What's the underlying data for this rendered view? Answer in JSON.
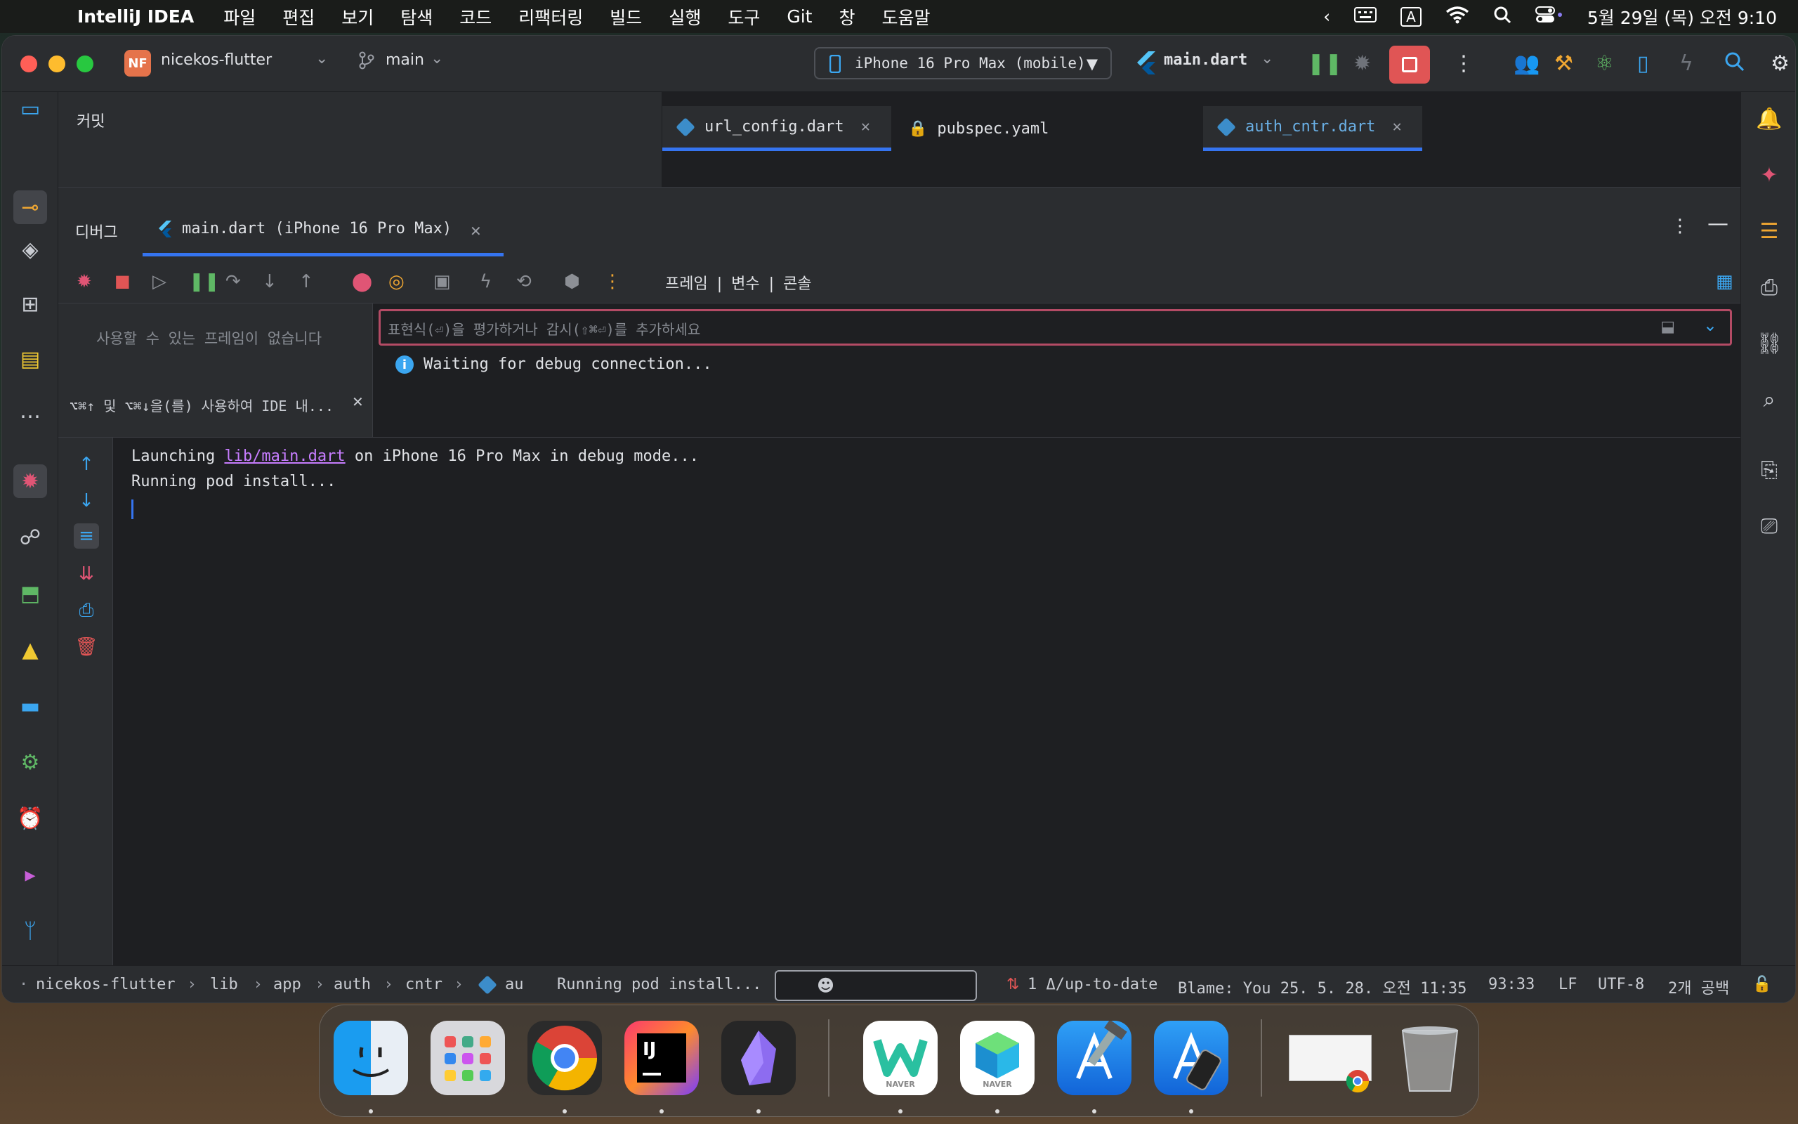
{
  "menubar": {
    "app": "IntelliJ IDEA",
    "items": [
      "파일",
      "편집",
      "보기",
      "탐색",
      "코드",
      "리팩터링",
      "빌드",
      "실행",
      "도구",
      "Git",
      "창",
      "도움말"
    ],
    "input_source": "A",
    "datetime": "5월 29일 (목) 오전 9:10"
  },
  "titlebar": {
    "project_badge": "NF",
    "project": "nicekos-flutter",
    "branch": "main",
    "device": "iPhone 16 Pro Max (mobile)",
    "run_config": "main.dart"
  },
  "commit_panel": {
    "title": "커밋"
  },
  "editor_tabs": [
    {
      "label": "url_config.dart"
    },
    {
      "label": "pubspec.yaml"
    },
    {
      "label": "auth_cntr.dart"
    }
  ],
  "debug": {
    "title": "디버그",
    "session_tab": "main.dart (iPhone 16 Pro Max)",
    "view_tabs": [
      "프레임",
      "|",
      "변수",
      "|",
      "콘솔"
    ],
    "frames_empty": "사용할 수 있는 프레임이 없습니다",
    "frames_hint": "⌥⌘↑ 및 ⌥⌘↓을(를) 사용하여 IDE 내...",
    "eval_placeholder": "표현식(⏎)을 평가하거나 감시(⇧⌘⏎)를 추가하세요",
    "waiting": "Waiting for debug connection...",
    "console": {
      "launch_prefix": "Launching ",
      "launch_link": "lib/main.dart",
      "launch_suffix": " on iPhone 16 Pro Max in debug mode...",
      "line2": "Running pod install..."
    }
  },
  "statusbar": {
    "breadcrumb": [
      "nicekos-flutter",
      "lib",
      "app",
      "auth",
      "cntr",
      "au"
    ],
    "task": "Running pod install...",
    "vcs": "1 Δ/up-to-date",
    "blame": "Blame: You 25. 5. 28. 오전 11:35",
    "position": "93:33",
    "line_sep": "LF",
    "encoding": "UTF-8",
    "indent": "2개 공백"
  },
  "dock": {
    "apps": [
      "Finder",
      "Launchpad",
      "Chrome",
      "IntelliJ IDEA",
      "Obsidian",
      "NAVER Whale",
      "NAVER Box",
      "Xcode",
      "Simulator",
      "Recent Window",
      "Trash"
    ],
    "badges": {
      "whale": "NAVER",
      "box": "NAVER"
    }
  }
}
